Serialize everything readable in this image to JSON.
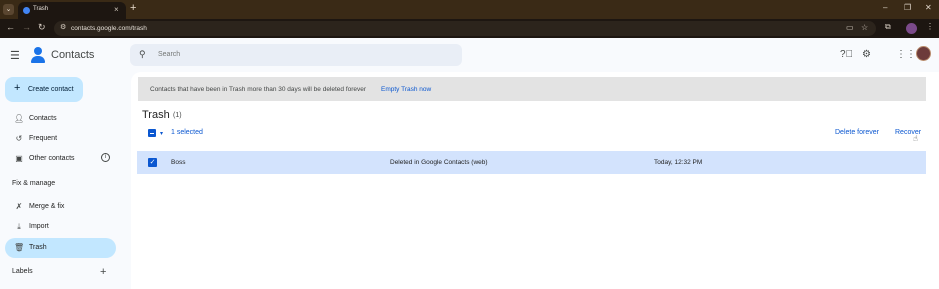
{
  "browser": {
    "tab_title": "Trash",
    "url": "contacts.google.com/trash"
  },
  "header": {
    "app_title": "Contacts",
    "search_placeholder": "Search"
  },
  "sidebar": {
    "create_label": "Create contact",
    "items": [
      {
        "label": "Contacts",
        "icon": "person-icon"
      },
      {
        "label": "Frequent",
        "icon": "history-icon"
      },
      {
        "label": "Other contacts",
        "icon": "contacts-box-icon"
      }
    ],
    "fix_section": "Fix & manage",
    "fix_items": [
      {
        "label": "Merge & fix",
        "icon": "merge-tools-icon"
      },
      {
        "label": "Import",
        "icon": "import-icon"
      },
      {
        "label": "Trash",
        "icon": "trash-icon",
        "active": true
      }
    ],
    "labels_section": "Labels"
  },
  "main": {
    "banner_text": "Contacts that have been in Trash more than 30 days will be deleted forever",
    "banner_link": "Empty Trash now",
    "title": "Trash",
    "count": "(1)",
    "selected_text": "1 selected",
    "delete_forever": "Delete forever",
    "recover": "Recover",
    "rows": [
      {
        "name": "Boss",
        "status": "Deleted in Google Contacts (web)",
        "time": "Today, 12:32 PM"
      }
    ]
  },
  "colors": {
    "accent": "#0b57d0",
    "selected_row": "#d3e3fd",
    "active_nav": "#c2e7ff"
  }
}
